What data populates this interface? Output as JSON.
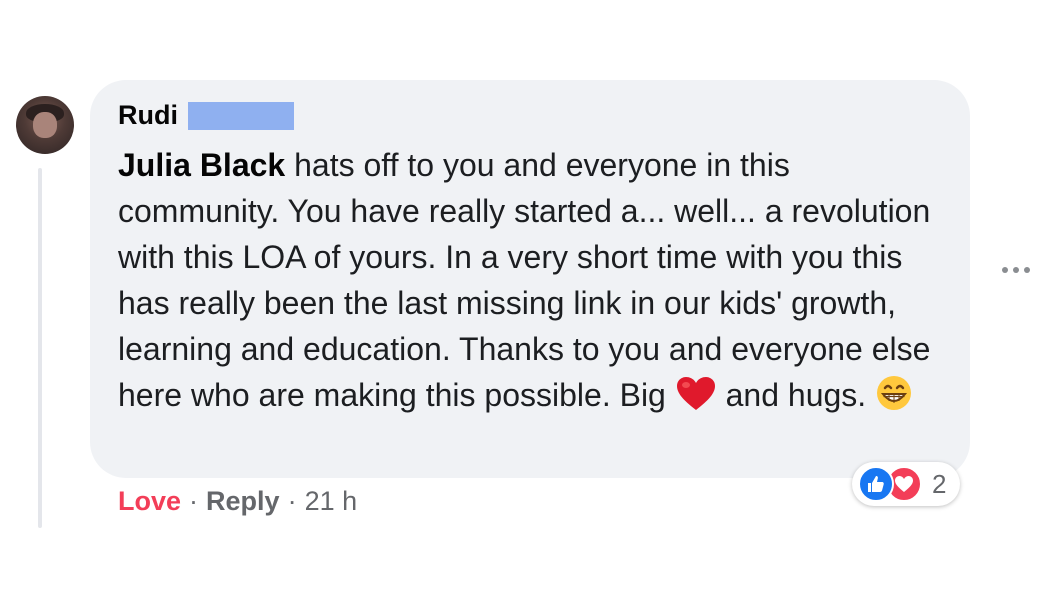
{
  "comment": {
    "author": "Rudi",
    "mention": "Julia Black",
    "text_main": " hats off to you and everyone in this community. You have really started a... well... a revolution with this LOA of yours. In a very short time with you this has really been the last missing link in our kids' growth, learning and education. Thanks to you and everyone else here who are making this possible. Big ",
    "text_after_heart": " and hugs. ",
    "emojis": [
      "red-heart",
      "grinning-face"
    ]
  },
  "reactions": {
    "types": [
      "like",
      "love"
    ],
    "count": "2"
  },
  "actions": {
    "love_label": "Love",
    "reply_label": "Reply",
    "separator": "·",
    "time": "21 h"
  },
  "colors": {
    "bubble": "#f0f2f5",
    "love_accent": "#f33e58",
    "like_blue": "#1877f2",
    "meta_gray": "#65676b",
    "redaction": "#8fb0f0"
  }
}
